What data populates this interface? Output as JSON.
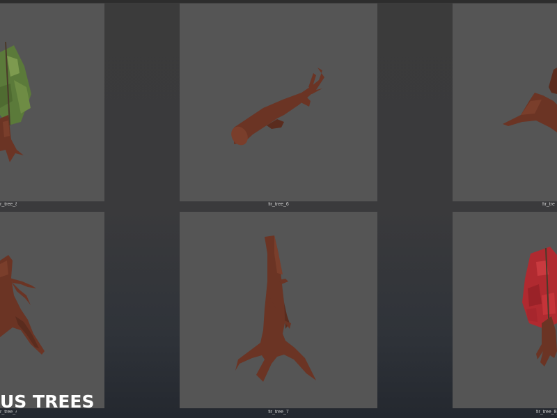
{
  "overlay_title": "US TREES",
  "footer_caption": "",
  "thumbnails": [
    {
      "label": "r_tree_8",
      "color": "#6b3424",
      "foliage": "green"
    },
    {
      "label": "fir_tree_6",
      "color": "#6b3424"
    },
    {
      "label": "fir_tre",
      "color": "#6b3424"
    },
    {
      "label": "r_tree_4",
      "color": "#6b3424"
    },
    {
      "label": "fir_tree_7",
      "color": "#6b3424"
    },
    {
      "label": "fir_tree_8_",
      "color": "#6b3424",
      "foliage": "red"
    }
  ]
}
